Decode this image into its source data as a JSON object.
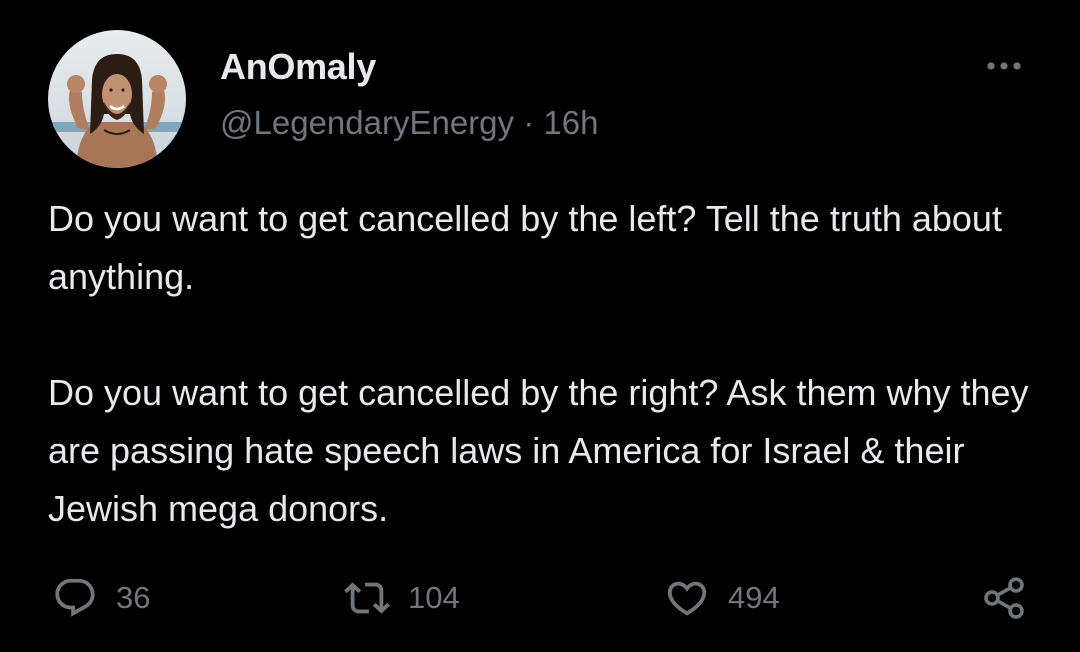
{
  "tweet": {
    "display_name": "AnOmaly",
    "handle": "@LegendaryEnergy",
    "separator": "·",
    "time": "16h",
    "body": "Do you want to get cancelled by the left? Tell the truth about anything.\n\nDo you want to get cancelled by the right? Ask them why they are passing hate speech laws in America for Israel & their Jewish mega donors.",
    "avatar_icon": "profile-photo",
    "more_icon": "ellipsis-icon"
  },
  "actions": {
    "reply_count": "36",
    "retweet_count": "104",
    "like_count": "494",
    "reply_icon": "reply-icon",
    "retweet_icon": "retweet-icon",
    "like_icon": "heart-icon",
    "share_icon": "share-icon"
  },
  "colors": {
    "background": "#000000",
    "text_primary": "#e7e9ea",
    "text_secondary": "#71767b"
  }
}
